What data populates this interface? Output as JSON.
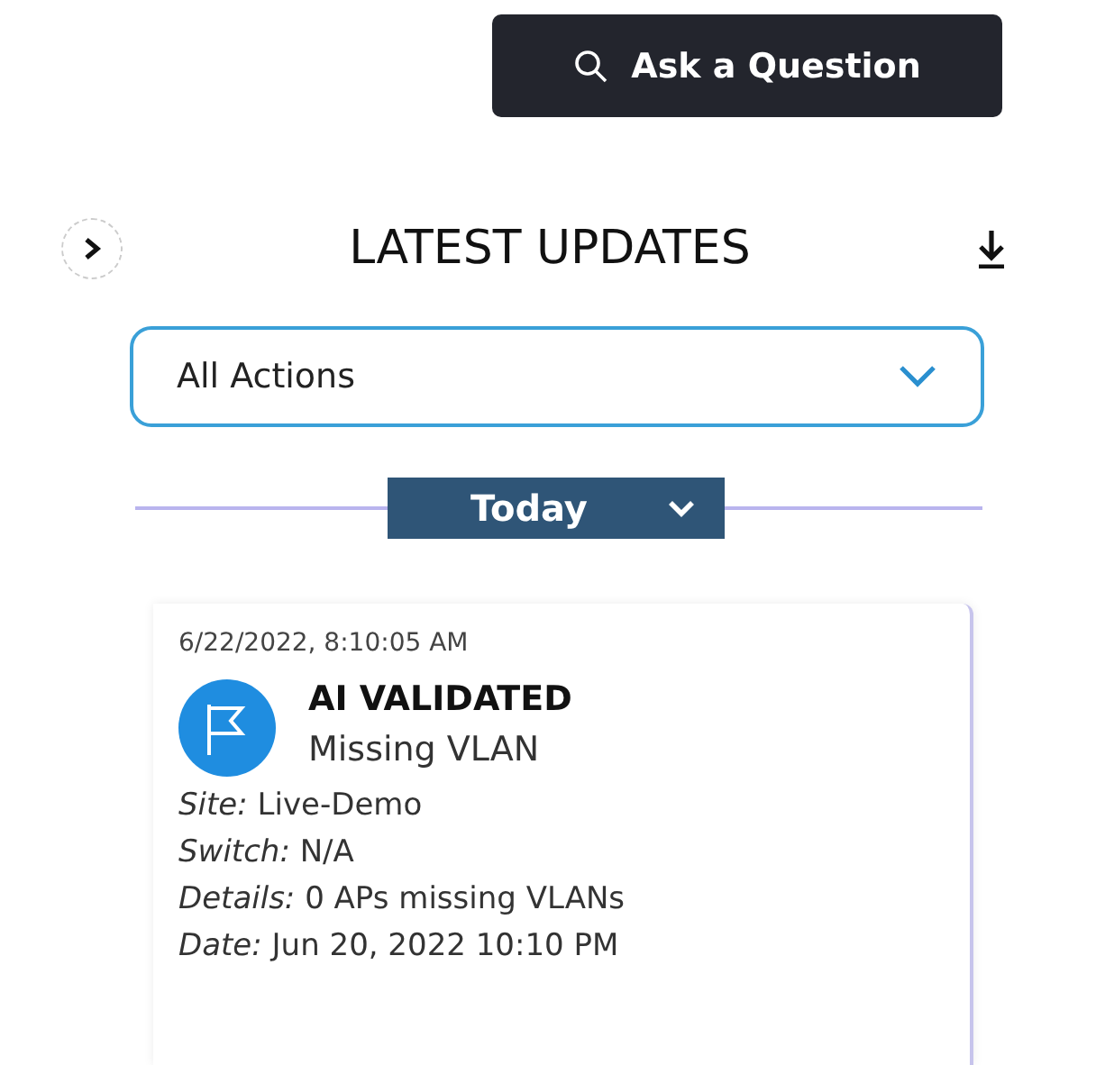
{
  "ask_button": {
    "label": "Ask a Question"
  },
  "panel": {
    "title": "LATEST UPDATES",
    "filter": {
      "value": "All Actions"
    },
    "period": {
      "label": "Today"
    },
    "updates": [
      {
        "timestamp": "6/22/2022, 8:10:05 AM",
        "action": "AI VALIDATED",
        "subject": "Missing VLAN",
        "details": [
          {
            "label": "Site:",
            "value": "Live-Demo"
          },
          {
            "label": "Switch:",
            "value": "N/A"
          },
          {
            "label": "Details:",
            "value": "0 APs missing VLANs"
          },
          {
            "label": "Date:",
            "value": "Jun 20, 2022 10:10 PM"
          }
        ]
      }
    ]
  }
}
